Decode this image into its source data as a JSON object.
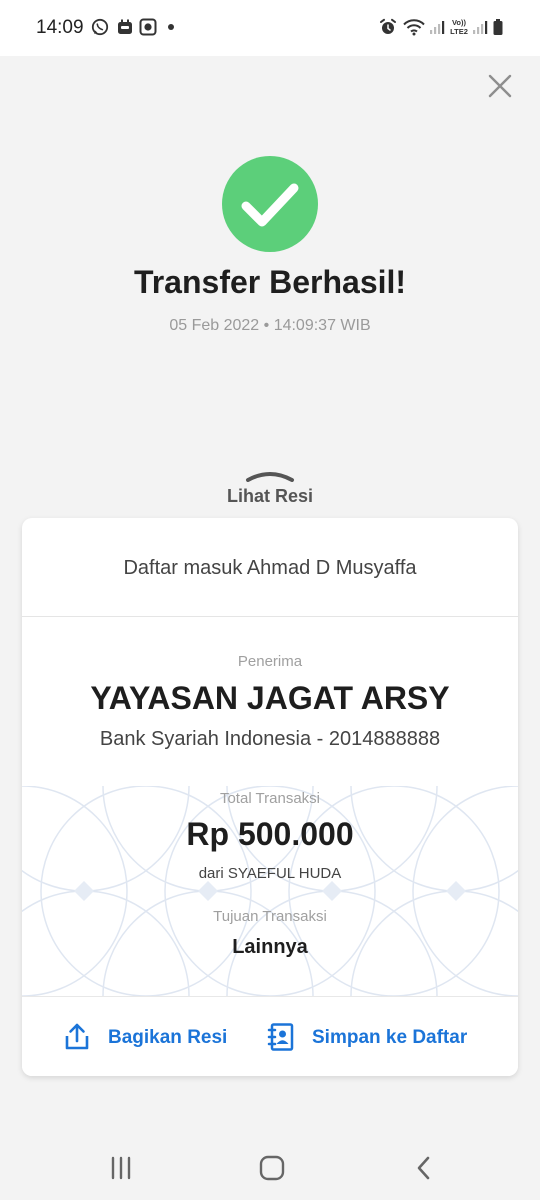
{
  "status_bar": {
    "time": "14:09",
    "icons": [
      "whatsapp-icon",
      "notification-icon",
      "screen-record-icon",
      "dot-icon",
      "alarm-icon",
      "wifi-icon",
      "signal-icon",
      "volte-lte2-icon",
      "signal-icon",
      "battery-icon"
    ]
  },
  "header": {
    "close_icon": "close-icon",
    "success_icon": "checkmark-icon",
    "success_color": "#5ccf7a",
    "title": "Transfer Berhasil!",
    "datetime": "05 Feb 2022 • 14:09:37 WIB"
  },
  "receipt_toggle": {
    "label": "Lihat Resi",
    "icon": "chevron-up-icon"
  },
  "card": {
    "header_text": "Daftar masuk Ahmad D Musyaffa",
    "recipient_label": "Penerima",
    "recipient_name": "YAYASAN JAGAT ARSY",
    "recipient_bank": "Bank Syariah Indonesia - 2014888888",
    "total_label": "Total Transaksi",
    "amount": "Rp 500.000",
    "from": "dari SYAEFUL HUDA",
    "purpose_label": "Tujuan Transaksi",
    "purpose": "Lainnya"
  },
  "actions": {
    "share_label": "Bagikan Resi",
    "share_icon": "share-icon",
    "save_label": "Simpan ke Daftar",
    "save_icon": "contact-book-icon",
    "accent_color": "#1b74d8"
  },
  "nav_bar": {
    "recents_icon": "recents-icon",
    "home_icon": "home-icon",
    "back_icon": "back-icon"
  }
}
